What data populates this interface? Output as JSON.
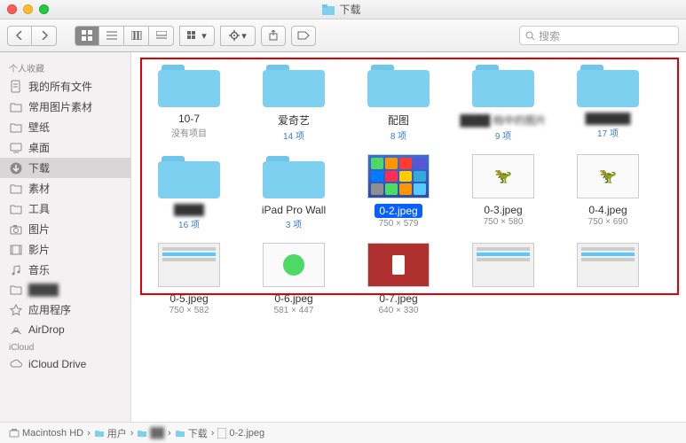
{
  "window": {
    "title": "下载",
    "icon": "folder-icon"
  },
  "toolbar": {
    "search_placeholder": "搜索"
  },
  "sidebar": {
    "sections": [
      {
        "header": "个人收藏",
        "items": [
          {
            "icon": "doc",
            "label": "我的所有文件"
          },
          {
            "icon": "folder",
            "label": "常用图片素材"
          },
          {
            "icon": "folder",
            "label": "壁纸"
          },
          {
            "icon": "desktop",
            "label": "桌面"
          },
          {
            "icon": "download",
            "label": "下载",
            "selected": true
          },
          {
            "icon": "folder",
            "label": "素材"
          },
          {
            "icon": "folder",
            "label": "工具"
          },
          {
            "icon": "camera",
            "label": "图片"
          },
          {
            "icon": "film",
            "label": "影片"
          },
          {
            "icon": "music",
            "label": "音乐"
          },
          {
            "icon": "folder",
            "label": "████",
            "blur": true
          },
          {
            "icon": "app",
            "label": "应用程序"
          },
          {
            "icon": "airdrop",
            "label": "AirDrop"
          }
        ]
      },
      {
        "header": "iCloud",
        "items": [
          {
            "icon": "cloud",
            "label": "iCloud Drive"
          }
        ]
      }
    ]
  },
  "files": [
    {
      "type": "folder",
      "name": "10-7",
      "sub": "没有项目"
    },
    {
      "type": "folder",
      "name": "爱奇艺",
      "sub": "14 项",
      "blue": true
    },
    {
      "type": "folder",
      "name": "配图",
      "sub": "8 项",
      "blue": true
    },
    {
      "type": "folder",
      "name": "████ 档中的图片",
      "sub": "9 项",
      "blue": true,
      "blur": true
    },
    {
      "type": "folder",
      "name": "██████",
      "sub": "17 项",
      "blue": true,
      "blur": true
    },
    {
      "type": "folder",
      "name": "████",
      "sub": "16 项",
      "blue": true,
      "blur": true
    },
    {
      "type": "folder",
      "name": "iPad Pro Wall",
      "sub": "3 项",
      "blue": true
    },
    {
      "type": "image",
      "name": "0-2.jpeg",
      "sub": "750 × 579",
      "selected": true,
      "preview": "ios"
    },
    {
      "type": "image",
      "name": "0-3.jpeg",
      "sub": "750 × 580",
      "preview": "dino"
    },
    {
      "type": "image",
      "name": "0-4.jpeg",
      "sub": "750 × 690",
      "preview": "dino"
    },
    {
      "type": "image",
      "name": "0-5.jpeg",
      "sub": "750 × 582",
      "preview": "screenshot"
    },
    {
      "type": "image",
      "name": "0-6.jpeg",
      "sub": "581 × 447",
      "preview": "green"
    },
    {
      "type": "image",
      "name": "0-7.jpeg",
      "sub": "640 × 330",
      "preview": "dark"
    },
    {
      "type": "image",
      "name": "",
      "sub": "",
      "preview": "screenshot"
    },
    {
      "type": "image",
      "name": "",
      "sub": "",
      "preview": "screenshot"
    }
  ],
  "path": [
    "Macintosh HD",
    "用户",
    "██",
    "下载",
    "0-2.jpeg"
  ]
}
